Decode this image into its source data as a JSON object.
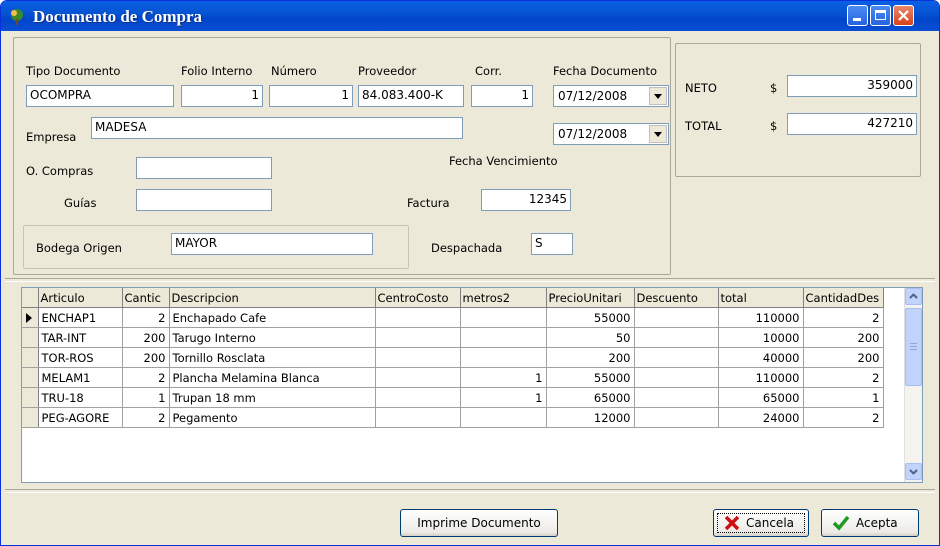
{
  "window": {
    "title": "Documento de Compra"
  },
  "form": {
    "tipo_documento": {
      "label": "Tipo Documento",
      "value": "OCOMPRA"
    },
    "folio_interno": {
      "label": "Folio Interno",
      "value": "1"
    },
    "numero": {
      "label": "Número",
      "value": "1"
    },
    "proveedor": {
      "label": "Proveedor",
      "value": "84.083.400-K"
    },
    "corr": {
      "label": "Corr.",
      "value": "1"
    },
    "fecha_documento": {
      "label": "Fecha Documento",
      "value": "07/12/2008"
    },
    "fecha_vencimiento": {
      "label": "Fecha Vencimiento",
      "value": "07/12/2008"
    },
    "empresa": {
      "label": "Empresa",
      "value": "MADESA"
    },
    "o_compras": {
      "label": "O. Compras",
      "value": ""
    },
    "guias": {
      "label": "Guías",
      "value": ""
    },
    "factura": {
      "label": "Factura",
      "value": "12345"
    },
    "bodega_origen": {
      "label": "Bodega Origen",
      "value": "MAYOR"
    },
    "despachada": {
      "label": "Despachada",
      "value": "S"
    }
  },
  "totals": {
    "neto": {
      "label": "NETO",
      "currency": "$",
      "value": "359000"
    },
    "total": {
      "label": "TOTAL",
      "currency": "$",
      "value": "427210"
    }
  },
  "grid": {
    "columns": [
      "Articulo",
      "Cantic",
      "Descripcion",
      "CentroCosto",
      "metros2",
      "PrecioUnitari",
      "Descuento",
      "total",
      "CantidadDes"
    ],
    "rows": [
      [
        "ENCHAP1",
        "2",
        "Enchapado Cafe",
        "",
        "",
        "55000",
        "",
        "110000",
        "2"
      ],
      [
        "TAR-INT",
        "200",
        "Tarugo Interno",
        "",
        "",
        "50",
        "",
        "10000",
        "200"
      ],
      [
        "TOR-ROS",
        "200",
        "Tornillo Rosclata",
        "",
        "",
        "200",
        "",
        "40000",
        "200"
      ],
      [
        "MELAM1",
        "2",
        "Plancha Melamina Blanca",
        "",
        "1",
        "55000",
        "",
        "110000",
        "2"
      ],
      [
        "TRU-18",
        "1",
        "Trupan 18 mm",
        "",
        "1",
        "65000",
        "",
        "65000",
        "1"
      ],
      [
        "PEG-AGORE",
        "2",
        "Pegamento",
        "",
        "",
        "12000",
        "",
        "24000",
        "2"
      ]
    ]
  },
  "buttons": {
    "imprime": "Imprime Documento",
    "cancela": "Cancela",
    "acepta": "Acepta"
  }
}
